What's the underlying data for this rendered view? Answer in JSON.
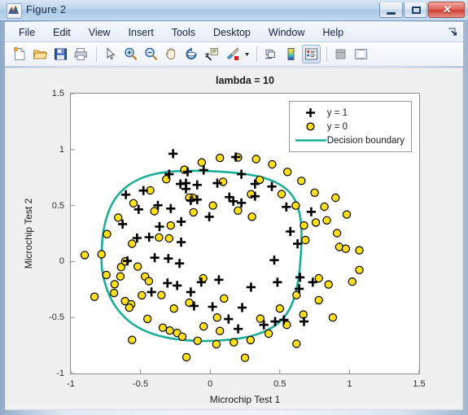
{
  "window": {
    "title": "Figure 2",
    "icon": "matlab-membrane-icon",
    "buttons": {
      "minimize": "minimize-icon",
      "maximize": "maximize-icon",
      "close": "close-icon",
      "close_glyph": "✕"
    }
  },
  "menu": {
    "items": [
      "File",
      "Edit",
      "View",
      "Insert",
      "Tools",
      "Desktop",
      "Window",
      "Help"
    ],
    "dock_control": "dock-arrow-icon"
  },
  "toolbar": {
    "buttons": [
      {
        "name": "new-figure-button",
        "icon": "new-document-icon"
      },
      {
        "name": "open-file-button",
        "icon": "open-folder-icon"
      },
      {
        "name": "save-figure-button",
        "icon": "save-floppy-icon"
      },
      {
        "name": "print-figure-button",
        "icon": "printer-icon"
      },
      {
        "name": "edit-plot-button",
        "icon": "arrow-pointer-icon"
      },
      {
        "name": "zoom-in-button",
        "icon": "zoom-in-icon"
      },
      {
        "name": "zoom-out-button",
        "icon": "zoom-out-icon"
      },
      {
        "name": "pan-button",
        "icon": "hand-pan-icon"
      },
      {
        "name": "rotate-3d-button",
        "icon": "rotate-3d-icon"
      },
      {
        "name": "data-cursor-button",
        "icon": "data-cursor-icon"
      },
      {
        "name": "brush-button",
        "icon": "brush-icon"
      },
      {
        "name": "brush-dropdown",
        "icon": "chevron-down-icon"
      },
      {
        "name": "link-plot-button",
        "icon": "link-plot-icon"
      },
      {
        "name": "colorbar-button",
        "icon": "colorbar-icon"
      },
      {
        "name": "legend-button",
        "icon": "legend-icon",
        "pressed": true
      },
      {
        "name": "hide-plot-tools-button",
        "icon": "hide-plot-tools-icon",
        "disabled": true
      },
      {
        "name": "show-plot-tools-button",
        "icon": "show-plot-tools-icon"
      }
    ]
  },
  "chart_data": {
    "type": "scatter",
    "title": "lambda = 10",
    "xlabel": "Microchip Test 1",
    "ylabel": "Microchip Test 2",
    "xlim": [
      -1,
      1.5
    ],
    "ylim": [
      -1,
      1.5
    ],
    "xticks": [
      "-1",
      "-0.5",
      "0",
      "0.5",
      "1",
      "1.5"
    ],
    "xtick_values": [
      -1,
      -0.5,
      0,
      0.5,
      1,
      1.5
    ],
    "yticks": [
      "1.5",
      "1",
      "0.5",
      "0",
      "-0.5",
      "-1"
    ],
    "ytick_values": [
      1.5,
      1,
      0.5,
      0,
      -0.5,
      -1
    ],
    "grid": false,
    "legend_position": "upper right",
    "legend": [
      {
        "label": "y = 1",
        "marker": "plus",
        "color": "#000000"
      },
      {
        "label": "y = 0",
        "marker": "circle",
        "color": "#FFE01B",
        "edge": "#000000"
      },
      {
        "label": "Decision boundary",
        "marker": "line",
        "color": "#1AAE96"
      }
    ],
    "series": [
      {
        "name": "y = 1",
        "marker": "plus",
        "color": "#000000",
        "points": [
          [
            0.051267,
            0.69956
          ],
          [
            -0.092742,
            0.68494
          ],
          [
            -0.21371,
            0.69225
          ],
          [
            -0.375,
            0.50219
          ],
          [
            -0.51325,
            0.46564
          ],
          [
            -0.52477,
            0.2098
          ],
          [
            -0.39804,
            0.034357
          ],
          [
            -0.30588,
            -0.19225
          ],
          [
            0.016705,
            -0.40424
          ],
          [
            0.13191,
            -0.51389
          ],
          [
            0.38537,
            -0.56506
          ],
          [
            0.52938,
            -0.5212
          ],
          [
            0.63882,
            -0.24342
          ],
          [
            0.73675,
            -0.18494
          ],
          [
            0.54666,
            0.48757
          ],
          [
            0.322,
            0.5826
          ],
          [
            0.16647,
            0.53874
          ],
          [
            -0.046659,
            0.81652
          ],
          [
            -0.17339,
            0.69956
          ],
          [
            -0.47869,
            0.63377
          ],
          [
            -0.60541,
            0.59722
          ],
          [
            -0.62846,
            0.33406
          ],
          [
            -0.59389,
            0.005117
          ],
          [
            -0.42108,
            -0.27266
          ],
          [
            -0.11578,
            -0.39693
          ],
          [
            0.20104,
            -0.60161
          ],
          [
            0.46601,
            -0.53582
          ],
          [
            0.67339,
            -0.53582
          ],
          [
            -0.13882,
            0.54605
          ],
          [
            -0.29435,
            0.77997
          ],
          [
            -0.26555,
            0.96272
          ],
          [
            -0.16187,
            0.8019
          ],
          [
            -0.17339,
            0.64839
          ],
          [
            -0.28283,
            0.47295
          ],
          [
            -0.36348,
            0.31213
          ],
          [
            -0.30012,
            0.027047
          ],
          [
            -0.23675,
            -0.21418
          ],
          [
            -0.06394,
            -0.18494
          ],
          [
            0.062788,
            -0.16301
          ],
          [
            0.22984,
            -0.41155
          ],
          [
            0.2932,
            -0.2288
          ],
          [
            0.48329,
            -0.18494
          ],
          [
            0.64459,
            -0.14108
          ],
          [
            0.46025,
            0.012427
          ],
          [
            0.6273,
            0.15863
          ],
          [
            0.57546,
            0.26827
          ],
          [
            0.72523,
            0.44371
          ],
          [
            0.22408,
            0.52412
          ],
          [
            0.44297,
            0.67032
          ],
          [
            0.322,
            0.69225
          ],
          [
            0.13767,
            0.57529
          ],
          [
            -0.0063364,
            0.39985
          ],
          [
            -0.092742,
            0.55336
          ],
          [
            -0.20795,
            0.35599
          ],
          [
            -0.20795,
            0.17325
          ],
          [
            -0.43836,
            0.21711
          ],
          [
            -0.21947,
            -0.016813
          ],
          [
            -0.13882,
            -0.27266
          ],
          [
            0.18376,
            0.93348
          ],
          [
            0.22408,
            0.77997
          ]
        ]
      },
      {
        "name": "y = 0",
        "marker": "circle",
        "color": "#FFE01B",
        "edge": "#000000",
        "points": [
          [
            0.92684,
            0.13003
          ],
          [
            1.0709,
            0.10015
          ],
          [
            -0.046659,
            -0.57968
          ],
          [
            -0.23675,
            -0.63816
          ],
          [
            -0.15035,
            -0.36769
          ],
          [
            -0.49021,
            -0.3019
          ],
          [
            -0.46717,
            -0.13377
          ],
          [
            -0.28923,
            -0.61662
          ],
          [
            -0.61041,
            -0.35391
          ],
          [
            -0.56634,
            -0.38196
          ],
          [
            -0.68586,
            -0.20256
          ],
          [
            -0.64428,
            -0.13308
          ],
          [
            -0.63882,
            -0.049558
          ],
          [
            -0.60974,
            0.0011342
          ],
          [
            -0.55997,
            0.15882
          ],
          [
            -0.36674,
            0.21483
          ],
          [
            -0.28283,
            0.32203
          ],
          [
            -0.29435,
            0.20673
          ],
          [
            -0.12633,
            0.57
          ],
          [
            -0.15035,
            0.57
          ],
          [
            0.092742,
            0.71197
          ],
          [
            0.2932,
            0.60099
          ],
          [
            0.35599,
            0.73044
          ],
          [
            0.51277,
            0.60231
          ],
          [
            0.61458,
            0.49939
          ],
          [
            0.67339,
            0.32203
          ],
          [
            0.68386,
            0.19198
          ],
          [
            0.75805,
            0.34913
          ],
          [
            0.83701,
            0.36748
          ],
          [
            0.91074,
            0.25397
          ],
          [
            0.9736,
            0.11424
          ],
          [
            1.0709,
            -0.075258
          ],
          [
            0.85,
            -0.2047
          ],
          [
            0.78,
            -0.345
          ],
          [
            0.66879,
            -0.47354
          ],
          [
            0.55,
            -0.5655
          ],
          [
            0.42,
            -0.64357
          ],
          [
            0.29,
            -0.7012
          ],
          [
            0.17,
            -0.7213
          ],
          [
            0.045,
            -0.7382
          ],
          [
            -0.09,
            -0.7082
          ],
          [
            -0.2,
            -0.6712
          ],
          [
            -0.34,
            -0.5912
          ],
          [
            -0.45,
            -0.5122
          ],
          [
            -0.58,
            -0.4123
          ],
          [
            -0.69,
            -0.2814
          ],
          [
            -0.745,
            -0.12
          ],
          [
            -0.78,
            0.065
          ],
          [
            -0.74,
            0.245
          ],
          [
            -0.66,
            0.392
          ],
          [
            -0.55,
            0.52
          ],
          [
            -0.43,
            0.635
          ],
          [
            -0.315,
            0.735
          ],
          [
            -0.185,
            0.82
          ],
          [
            -0.06,
            0.885
          ],
          [
            0.07,
            0.925
          ],
          [
            0.2,
            0.93
          ],
          [
            0.33,
            0.915
          ],
          [
            0.445,
            0.868
          ],
          [
            0.555,
            0.8
          ],
          [
            0.655,
            0.72
          ],
          [
            0.75,
            0.615
          ],
          [
            0.82,
            0.49
          ],
          [
            -0.9,
            0.058
          ],
          [
            -0.83,
            -0.315
          ],
          [
            -0.56,
            -0.7
          ],
          [
            -0.17,
            -0.855
          ],
          [
            0.25,
            -0.86
          ],
          [
            0.62,
            -0.735
          ],
          [
            0.88,
            -0.5
          ],
          [
            1.02,
            -0.18
          ],
          [
            0.98,
            0.42
          ],
          [
            0.9,
            0.57
          ],
          [
            0.78,
            -0.15
          ],
          [
            0.62,
            -0.3
          ],
          [
            0.5,
            -0.42
          ],
          [
            0.36,
            -0.51
          ],
          [
            -0.4,
            0.45
          ],
          [
            -0.12,
            0.44
          ],
          [
            0.02,
            0.5
          ],
          [
            0.2,
            0.455
          ],
          [
            0.3,
            0.4
          ],
          [
            -0.52,
            -0.045
          ],
          [
            -0.44,
            -0.175
          ],
          [
            -0.35,
            -0.3
          ],
          [
            -0.26,
            -0.42
          ],
          [
            0.05,
            -0.5
          ],
          [
            0.07,
            -0.62
          ],
          [
            -0.05,
            -0.15
          ],
          [
            0.1,
            -0.33
          ]
        ]
      }
    ],
    "decision_boundary": {
      "name": "Decision boundary",
      "color": "#1AAE96",
      "shape": "closed-squircle",
      "linewidth": 2,
      "path": [
        [
          -0.78,
          0.02
        ],
        [
          -0.775,
          0.22
        ],
        [
          -0.745,
          0.4
        ],
        [
          -0.695,
          0.545
        ],
        [
          -0.62,
          0.655
        ],
        [
          -0.52,
          0.735
        ],
        [
          -0.4,
          0.785
        ],
        [
          -0.26,
          0.808
        ],
        [
          -0.1,
          0.812
        ],
        [
          0.06,
          0.805
        ],
        [
          0.21,
          0.79
        ],
        [
          0.35,
          0.762
        ],
        [
          0.465,
          0.715
        ],
        [
          0.555,
          0.645
        ],
        [
          0.615,
          0.545
        ],
        [
          0.648,
          0.41
        ],
        [
          0.658,
          0.25
        ],
        [
          0.652,
          0.06
        ],
        [
          0.638,
          -0.13
        ],
        [
          0.612,
          -0.3
        ],
        [
          0.568,
          -0.44
        ],
        [
          0.5,
          -0.545
        ],
        [
          0.405,
          -0.62
        ],
        [
          0.285,
          -0.672
        ],
        [
          0.14,
          -0.7
        ],
        [
          -0.02,
          -0.712
        ],
        [
          -0.18,
          -0.705
        ],
        [
          -0.33,
          -0.678
        ],
        [
          -0.46,
          -0.628
        ],
        [
          -0.565,
          -0.555
        ],
        [
          -0.65,
          -0.455
        ],
        [
          -0.715,
          -0.335
        ],
        [
          -0.758,
          -0.19
        ],
        [
          -0.778,
          -0.06
        ],
        [
          -0.78,
          0.02
        ]
      ]
    }
  }
}
